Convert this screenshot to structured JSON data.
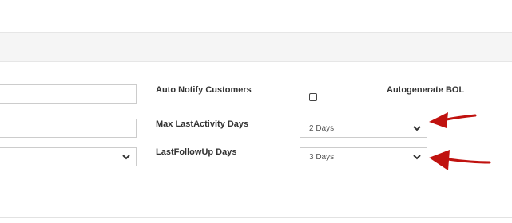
{
  "form": {
    "auto_notify_label": "Auto Notify Customers",
    "autogenerate_bol_label": "Autogenerate BOL",
    "max_last_activity_label": "Max LastActivity Days",
    "last_followup_label": "LastFollowUp Days",
    "max_last_activity_value": "2 Days",
    "last_followup_value": "3 Days",
    "auto_notify_checked": false
  },
  "annotations": {
    "arrow_color": "#c0120f"
  }
}
